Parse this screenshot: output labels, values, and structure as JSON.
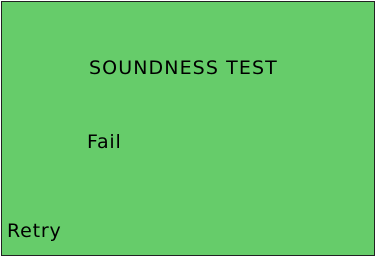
{
  "screen": {
    "background_color": "#66cc6a",
    "title": "SOUNDNESS TEST",
    "status": "Fail",
    "retry_label": "Retry"
  }
}
